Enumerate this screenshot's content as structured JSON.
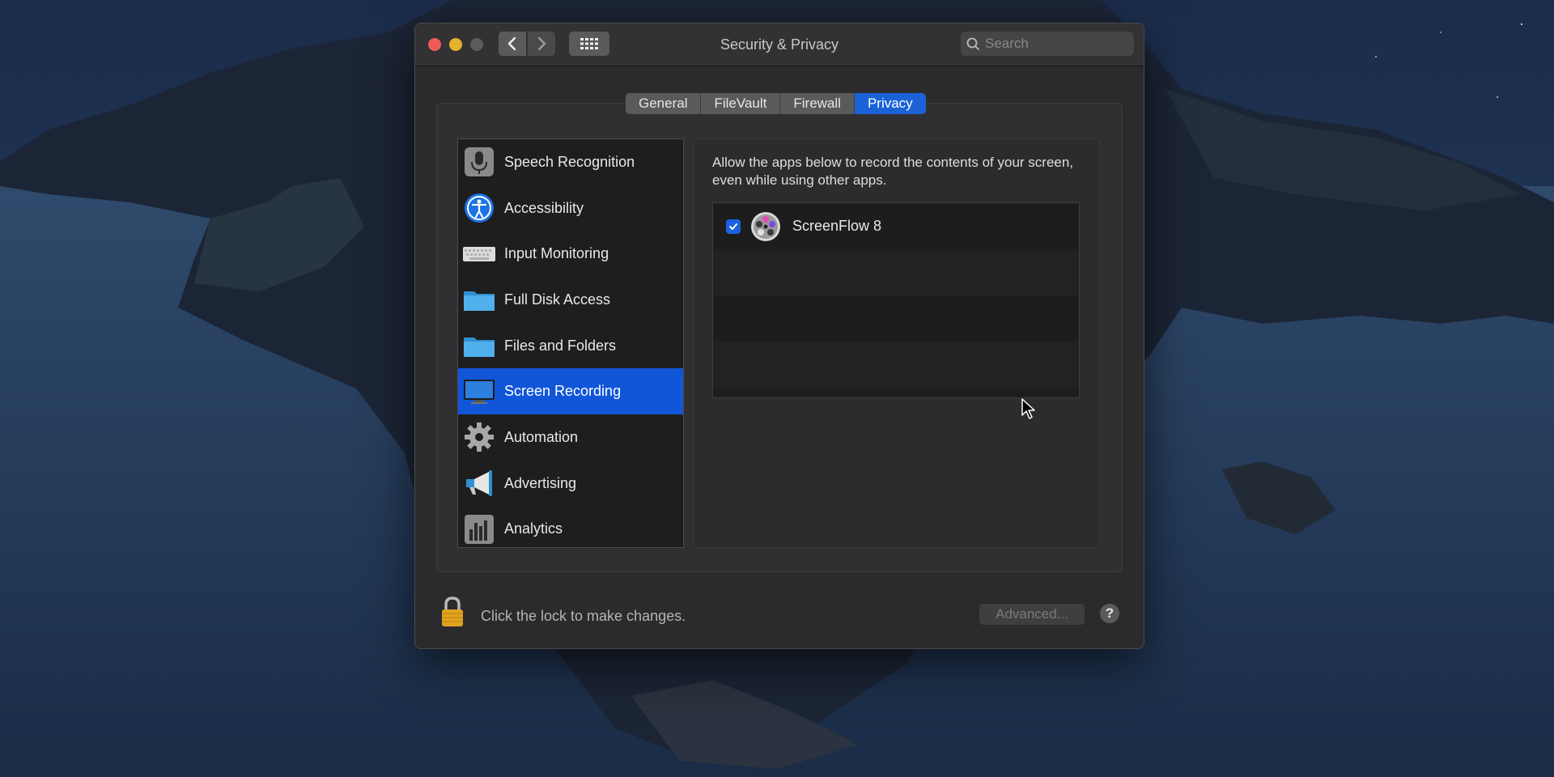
{
  "window": {
    "title": "Security & Privacy",
    "search_placeholder": "Search"
  },
  "tabs": [
    {
      "label": "General",
      "active": false
    },
    {
      "label": "FileVault",
      "active": false
    },
    {
      "label": "Firewall",
      "active": false
    },
    {
      "label": "Privacy",
      "active": true
    }
  ],
  "sidebar": {
    "items": [
      {
        "label": "Speech Recognition",
        "icon": "microphone-icon",
        "selected": false
      },
      {
        "label": "Accessibility",
        "icon": "accessibility-icon",
        "selected": false
      },
      {
        "label": "Input Monitoring",
        "icon": "keyboard-icon",
        "selected": false
      },
      {
        "label": "Full Disk Access",
        "icon": "folder-icon",
        "selected": false
      },
      {
        "label": "Files and Folders",
        "icon": "folder-icon",
        "selected": false
      },
      {
        "label": "Screen Recording",
        "icon": "display-icon",
        "selected": true
      },
      {
        "label": "Automation",
        "icon": "gear-icon",
        "selected": false
      },
      {
        "label": "Advertising",
        "icon": "megaphone-icon",
        "selected": false
      },
      {
        "label": "Analytics",
        "icon": "bar-chart-icon",
        "selected": false
      }
    ]
  },
  "detail": {
    "description": "Allow the apps below to record the contents of your screen, even while using other apps.",
    "apps": [
      {
        "name": "ScreenFlow 8",
        "checked": true,
        "icon": "screenflow-icon"
      }
    ]
  },
  "footer": {
    "lock_text": "Click the lock to make changes.",
    "advanced_label": "Advanced...",
    "help_label": "?"
  },
  "colors": {
    "accent": "#1b62d6",
    "selected_row": "#1156d9",
    "window_bg": "#2b2b2d",
    "close": "#ed5b56",
    "minimize": "#e3b12c"
  }
}
